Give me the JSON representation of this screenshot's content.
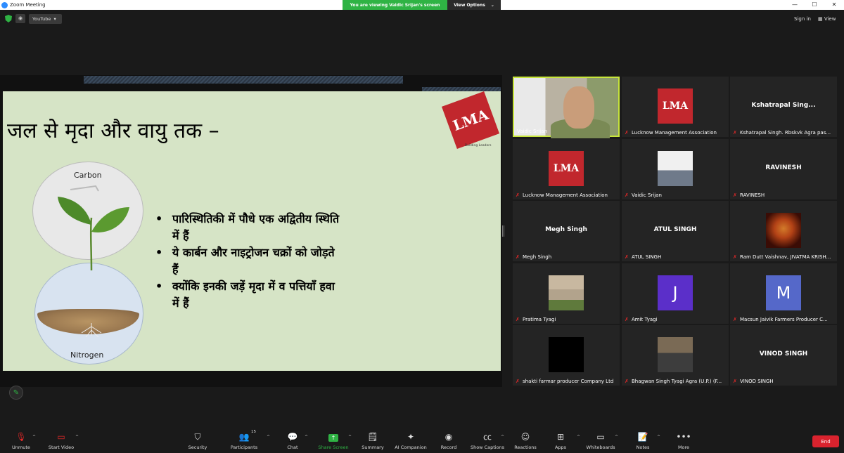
{
  "window": {
    "title": "Zoom Meeting",
    "banner_viewing": "You are viewing Vaidic Srijan's screen",
    "banner_view_options": "View Options",
    "controls": [
      "—",
      "☐",
      "✕"
    ]
  },
  "topbar": {
    "youtube_label": "YouTube",
    "sign_in": "Sign in",
    "view": "View"
  },
  "slide": {
    "title": "जल से मृदा और वायु तक –",
    "logo_text": "LMA",
    "logo_tag": "Building Leaders",
    "carbon_label": "Carbon",
    "nitrogen_label": "Nitrogen",
    "bullets": [
      "पारिस्थितिकी में पौधे एक अद्वितीय स्थिति में हैं",
      "ये कार्बन और नाइट्रोजन चक्रों को जोड़ते हैं",
      "क्योंकि इनकी जड़ें मृदा में व पत्तियाँ हवा में हैं"
    ]
  },
  "participants": [
    {
      "name": "Vaidic Srijan",
      "display": "",
      "type": "video",
      "active": true
    },
    {
      "name": "Lucknow Management Association",
      "display": "",
      "type": "lma"
    },
    {
      "name": "Kshatrapal Singh. Rbskvk Agra pas...",
      "display": "Kshatrapal  Sing...",
      "type": "text"
    },
    {
      "name": "Lucknow Management Association",
      "display": "",
      "type": "lma"
    },
    {
      "name": "Vaidic Srijan",
      "display": "",
      "type": "photo1"
    },
    {
      "name": "RAVINESH",
      "display": "RAVINESH",
      "type": "text"
    },
    {
      "name": "Megh Singh",
      "display": "Megh Singh",
      "type": "text"
    },
    {
      "name": "ATUL SINGH",
      "display": "ATUL SINGH",
      "type": "text"
    },
    {
      "name": "Ram Dutt Vaishnav, JIVATMA KRISH...",
      "display": "",
      "type": "photo3"
    },
    {
      "name": "Pratima Tyagi",
      "display": "",
      "type": "photo2"
    },
    {
      "name": "Amit Tyagi",
      "display": "J",
      "type": "letter",
      "color": "#5b2fc9"
    },
    {
      "name": "Macsun Jaivik Farmers Producer C...",
      "display": "M",
      "type": "letter",
      "color": "#5568c9"
    },
    {
      "name": "shakti farmar producer Company Ltd",
      "display": "",
      "type": "black"
    },
    {
      "name": "Bhagwan Singh Tyagi  Agra (U.P.) (F...",
      "display": "",
      "type": "photo4"
    },
    {
      "name": "VINOD SINGH",
      "display": "VINOD SINGH",
      "type": "text"
    }
  ],
  "toolbar": {
    "unmute": "Unmute",
    "start_video": "Start Video",
    "security": "Security",
    "participants": "Participants",
    "participants_count": "15",
    "chat": "Chat",
    "share_screen": "Share Screen",
    "summary": "Summary",
    "ai_companion": "AI Companion",
    "record": "Record",
    "show_captions": "Show Captions",
    "reactions": "Reactions",
    "apps": "Apps",
    "whiteboards": "Whiteboards",
    "notes": "Notes",
    "more": "More",
    "end": "End"
  }
}
